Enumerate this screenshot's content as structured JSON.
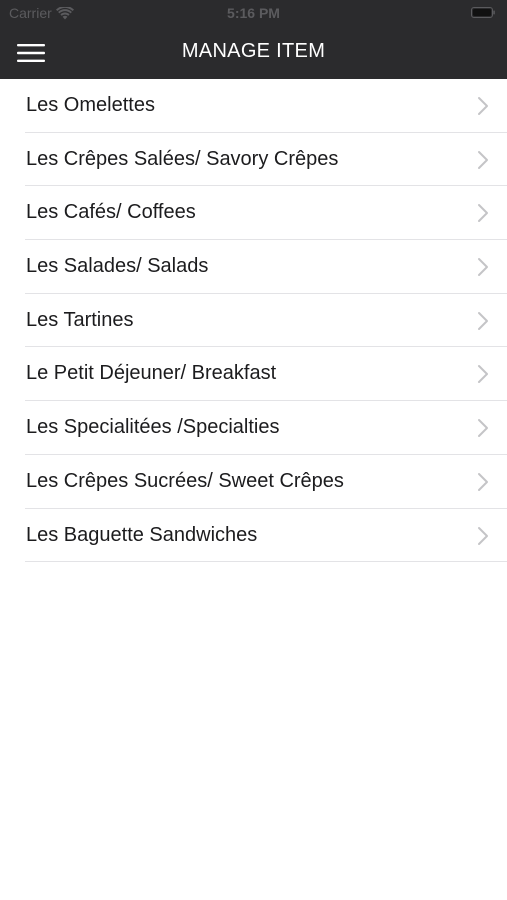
{
  "status_bar": {
    "carrier": "Carrier",
    "time": "5:16 PM"
  },
  "nav_bar": {
    "title": "MANAGE ITEM",
    "menu_icon": "hamburger-icon",
    "background_color": "#2b2b2d"
  },
  "categories": [
    {
      "label": "Les Omelettes"
    },
    {
      "label": "Les Crêpes Salées/ Savory Crêpes"
    },
    {
      "label": "Les Cafés/ Coffees"
    },
    {
      "label": "Les Salades/ Salads"
    },
    {
      "label": "Les Tartines"
    },
    {
      "label": "Le Petit Déjeuner/ Breakfast"
    },
    {
      "label": "Les Specialitées /Specialties"
    },
    {
      "label": "Les Crêpes Sucrées/ Sweet Crêpes"
    },
    {
      "label": "Les Baguette Sandwiches"
    }
  ],
  "row_icon": "chevron-right-icon"
}
